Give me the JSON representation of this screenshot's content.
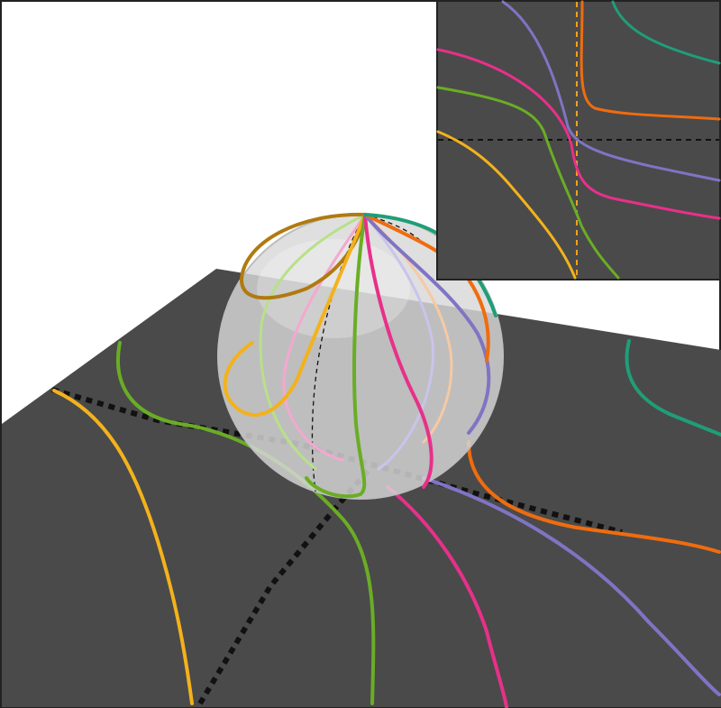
{
  "figure": {
    "colors": {
      "background": "#ffffff",
      "frame": "#222222",
      "plane": "#4a4a4a",
      "sphere_fill": "#d8d8d8",
      "sphere_stroke": "#bdbdbd",
      "dashed": "#111111",
      "axis_orange": "#f0a020"
    },
    "curve_colors": {
      "yellow": "#f3b21c",
      "green": "#6aad25",
      "magenta": "#e8308a",
      "purple": "#7f74c4",
      "orange": "#ef6c0f",
      "teal": "#1f9e78",
      "brown": "#b07a10",
      "light_green": "#b8e089",
      "pink": "#f4a8cf",
      "lavender": "#c9c4ec",
      "peach": "#f6c9a4"
    }
  }
}
